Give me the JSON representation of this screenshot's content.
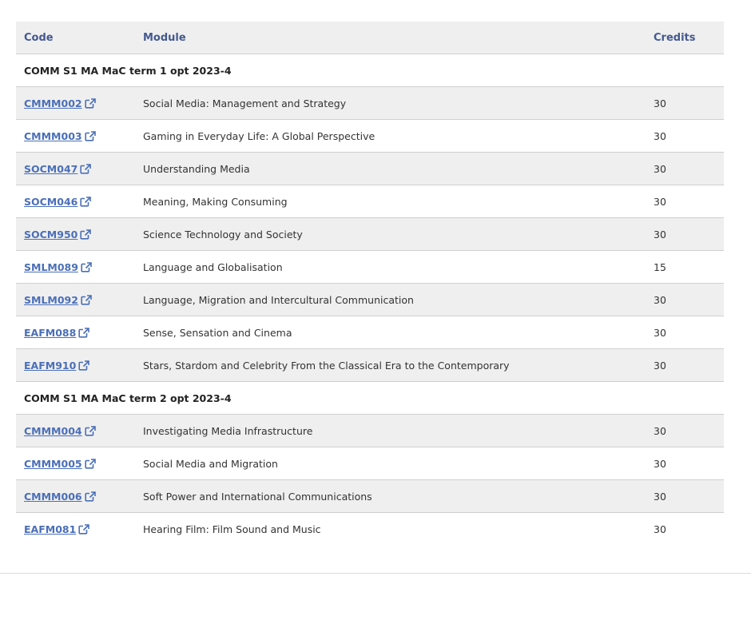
{
  "table": {
    "headers": {
      "code": "Code",
      "module": "Module",
      "credits": "Credits"
    },
    "groups": [
      {
        "title": "COMM S1 MA MaC term 1 opt 2023-4",
        "rows": [
          {
            "code": "CMMM002",
            "module": "Social Media: Management and Strategy",
            "credits": "30"
          },
          {
            "code": "CMMM003",
            "module": "Gaming in Everyday Life: A Global Perspective",
            "credits": "30"
          },
          {
            "code": "SOCM047",
            "module": "Understanding Media",
            "credits": "30"
          },
          {
            "code": "SOCM046",
            "module": "Meaning, Making Consuming",
            "credits": "30"
          },
          {
            "code": "SOCM950",
            "module": "Science Technology and Society",
            "credits": "30"
          },
          {
            "code": "SMLM089",
            "module": "Language and Globalisation",
            "credits": "15"
          },
          {
            "code": "SMLM092",
            "module": "Language, Migration and Intercultural Communication",
            "credits": "30"
          },
          {
            "code": "EAFM088",
            "module": "Sense, Sensation and Cinema",
            "credits": "30"
          },
          {
            "code": "EAFM910",
            "module": "Stars, Stardom and Celebrity From the Classical Era to the Contemporary",
            "credits": "30"
          }
        ]
      },
      {
        "title": "COMM S1 MA MaC term 2 opt 2023-4",
        "rows": [
          {
            "code": "CMMM004",
            "module": "Investigating Media Infrastructure",
            "credits": "30"
          },
          {
            "code": "CMMM005",
            "module": "Social Media and Migration",
            "credits": "30"
          },
          {
            "code": "CMMM006",
            "module": "Soft Power and International Communications",
            "credits": "30"
          },
          {
            "code": "EAFM081",
            "module": "Hearing Film: Film Sound and Music",
            "credits": "30"
          }
        ]
      }
    ]
  },
  "icons": {
    "code_link": "external-link-icon"
  },
  "colors": {
    "header_text": "#44598f",
    "link": "#4a6fb8",
    "row_shade": "#efefef",
    "border": "#cfcfcf"
  }
}
